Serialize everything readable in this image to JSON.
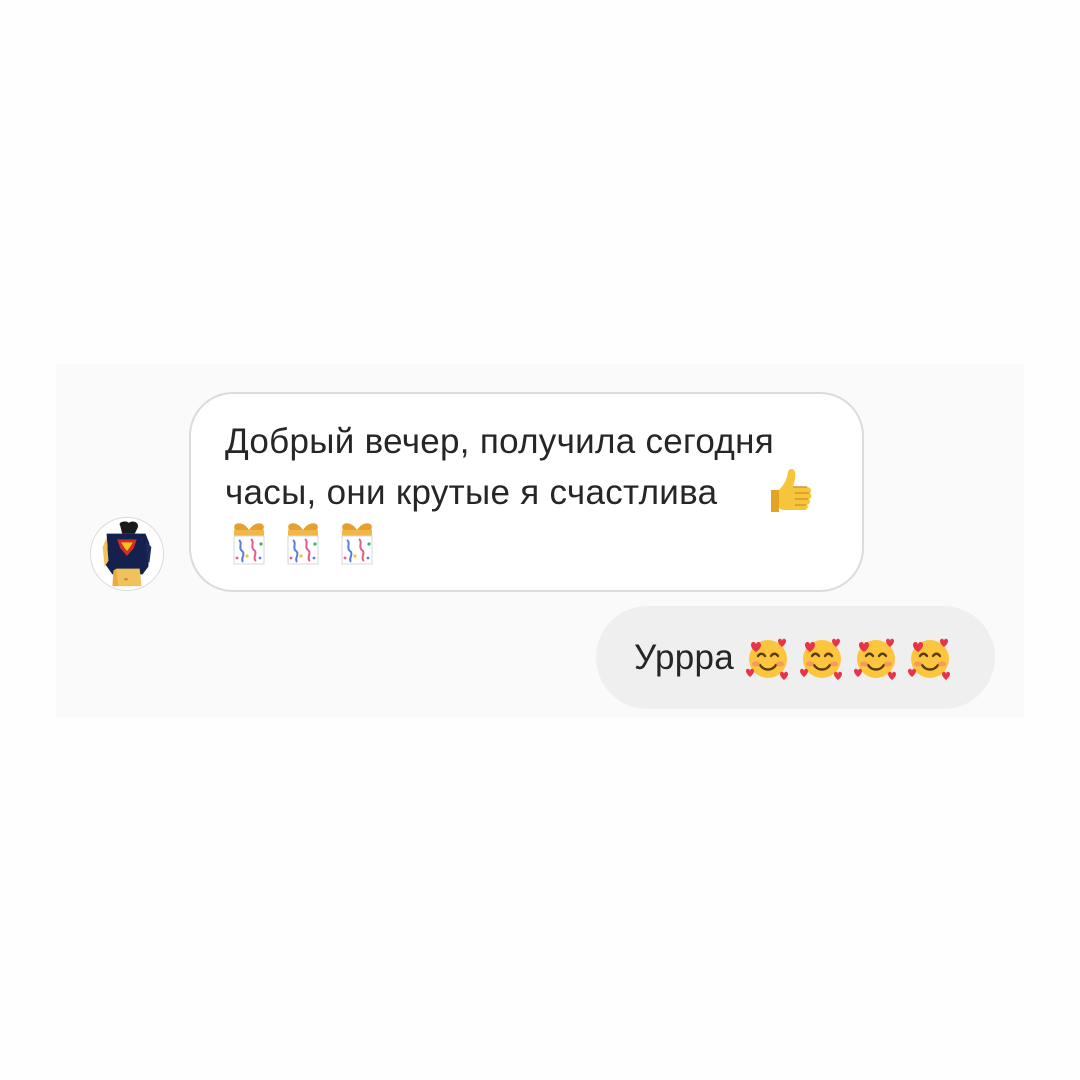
{
  "thread": {
    "incoming": {
      "line1": "Добрый вечер, получила сегодня",
      "line2": "часы, они крутые я счастлива",
      "trailing_emoji": "thumbs-up",
      "emoji_row": [
        "wrapped-gift",
        "wrapped-gift",
        "wrapped-gift"
      ]
    },
    "outgoing": {
      "text": "Урррa",
      "emoji_row": [
        "smiling-face-with-hearts",
        "smiling-face-with-hearts",
        "smiling-face-with-hearts",
        "smiling-face-with-hearts"
      ]
    }
  },
  "colors": {
    "page_background": "#fefefe",
    "panel_background": "#fafafa",
    "incoming_bubble": "#ffffff",
    "incoming_border": "#dbdbdb",
    "outgoing_bubble": "#efefef",
    "text": "#262626"
  }
}
